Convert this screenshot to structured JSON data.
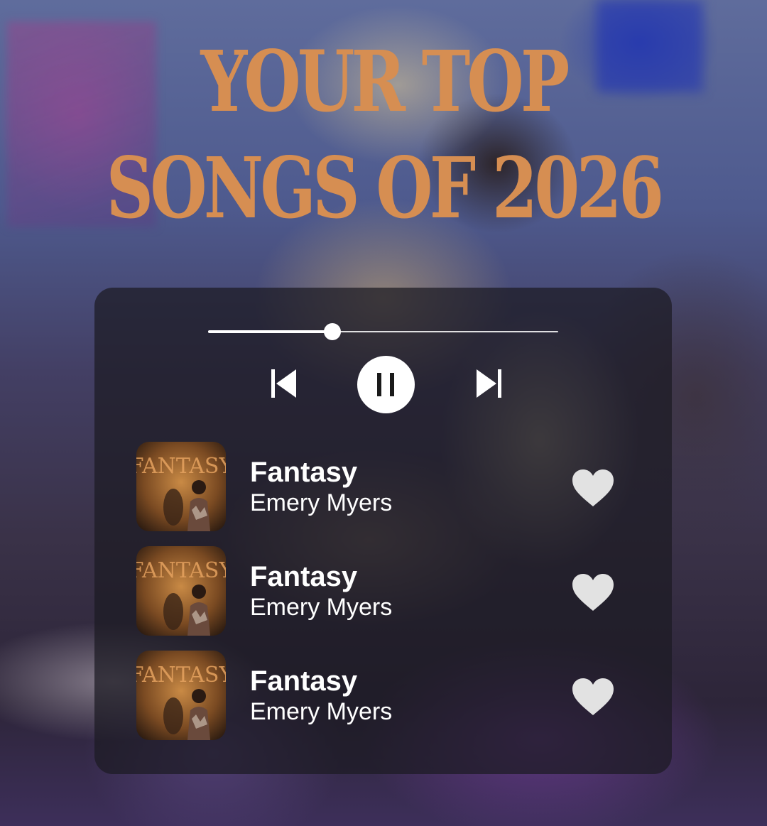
{
  "header": {
    "title_line_1": "YOUR TOP",
    "title_line_2": "SONGS OF 2026",
    "title_color": "#d68e52"
  },
  "player": {
    "progress_fraction": 0.355,
    "controls": {
      "previous": "skip-previous-icon",
      "play_pause": "pause-icon",
      "next": "skip-next-icon"
    }
  },
  "tracks": [
    {
      "title": "Fantasy",
      "artist": "Emery Myers",
      "cover_text": "FANTASY",
      "liked_icon": "heart-icon"
    },
    {
      "title": "Fantasy",
      "artist": "Emery Myers",
      "cover_text": "FANTASY",
      "liked_icon": "heart-icon"
    },
    {
      "title": "Fantasy",
      "artist": "Emery Myers",
      "cover_text": "FANTASY",
      "liked_icon": "heart-icon"
    }
  ]
}
